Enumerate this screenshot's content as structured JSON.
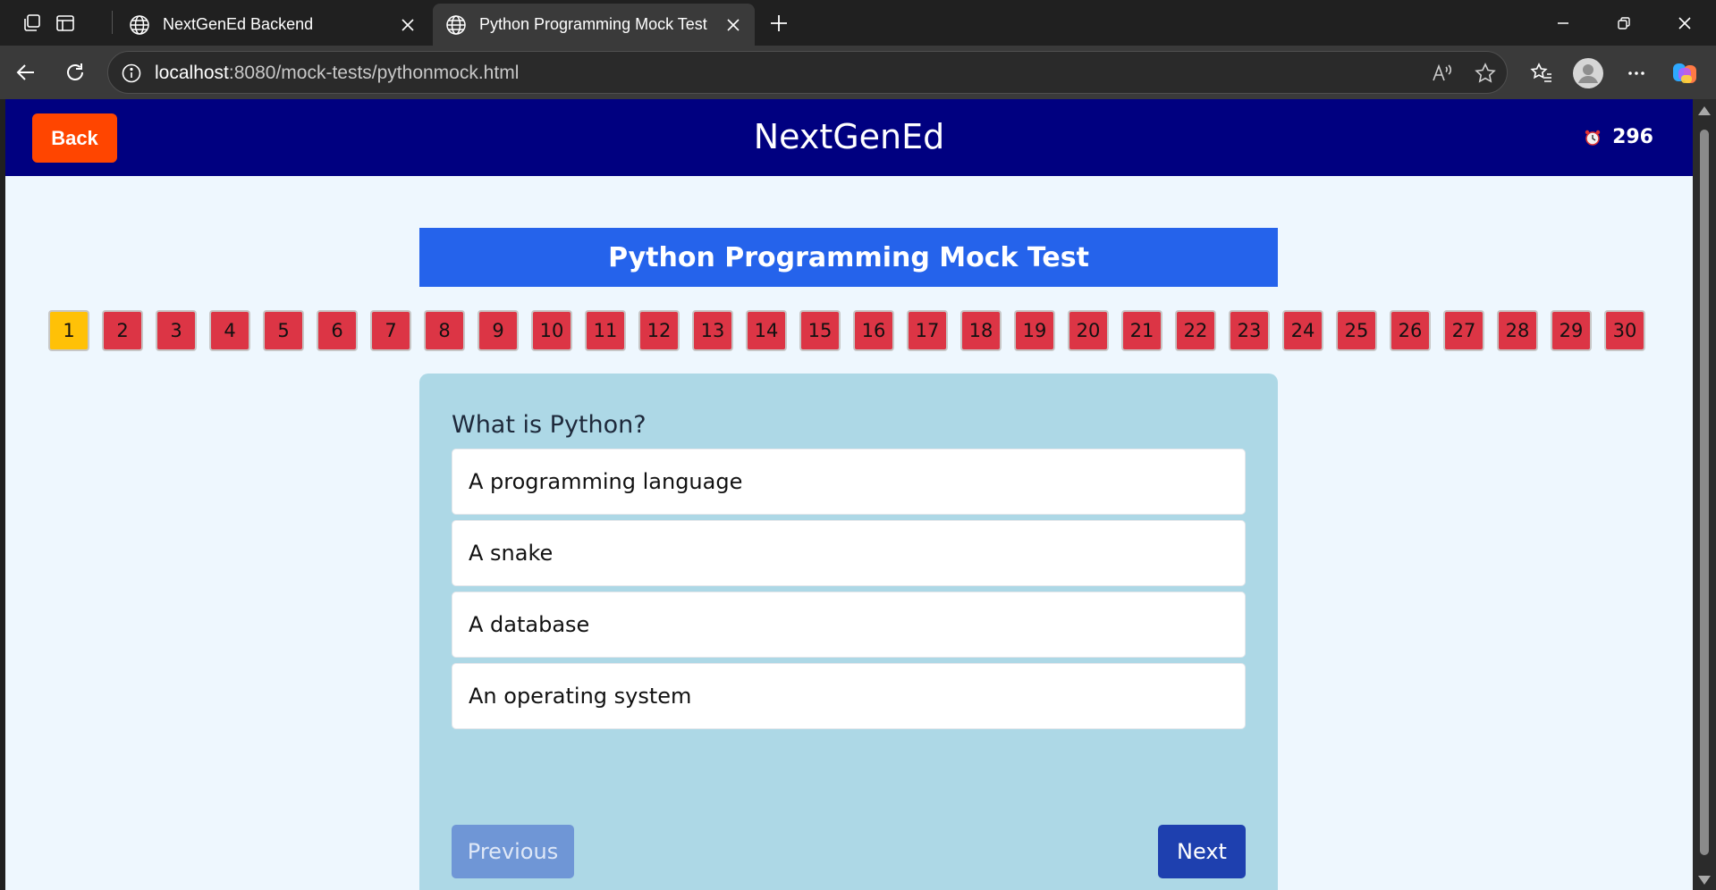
{
  "browser": {
    "tabs": [
      {
        "title": "NextGenEd Backend",
        "active": false
      },
      {
        "title": "Python Programming Mock Test",
        "active": true
      }
    ],
    "url_host": "localhost",
    "url_path": ":8080/mock-tests/pythonmock.html"
  },
  "header": {
    "back_label": "Back",
    "site_title": "NextGenEd",
    "timer_value": "296"
  },
  "test": {
    "title": "Python Programming Mock Test",
    "current_question": 1,
    "question_numbers": [
      "1",
      "2",
      "3",
      "4",
      "5",
      "6",
      "7",
      "8",
      "9",
      "10",
      "11",
      "12",
      "13",
      "14",
      "15",
      "16",
      "17",
      "18",
      "19",
      "20",
      "21",
      "22",
      "23",
      "24",
      "25",
      "26",
      "27",
      "28",
      "29",
      "30"
    ],
    "question": "What is Python?",
    "options": [
      "A programming language",
      "A snake",
      "A database",
      "An operating system"
    ],
    "prev_label": "Previous",
    "next_label": "Next"
  },
  "colors": {
    "header_bg": "#000080",
    "back_button": "#ff4500",
    "title_bar": "#2563eb",
    "qnum_default": "#dc3545",
    "qnum_current": "#ffc107",
    "card_bg": "#add8e6",
    "next_button": "#1e40af"
  }
}
